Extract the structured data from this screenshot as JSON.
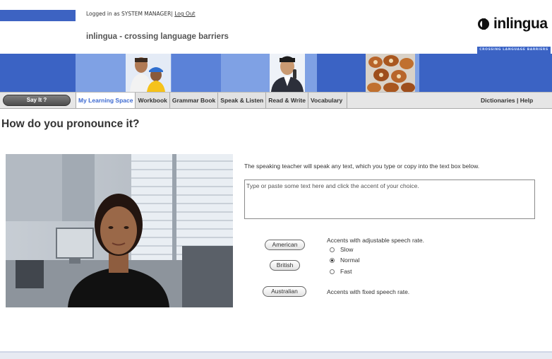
{
  "header": {
    "login_text": "Logged in as SYSTEM MANAGER|",
    "logout_label": "Log Out",
    "tagline": "inlingua - crossing language barriers",
    "logo_text": "inlingua",
    "banner_tagline": "CROSSING LANGUAGE BARRIERS"
  },
  "nav": {
    "say_it_label": "Say It ?",
    "tabs": [
      {
        "label": "My Learning Space",
        "active": true
      },
      {
        "label": "Workbook"
      },
      {
        "label": "Grammar Book"
      },
      {
        "label": "Speak & Listen"
      },
      {
        "label": "Read & Write"
      },
      {
        "label": "Vocabulary"
      }
    ],
    "dictionaries_label": "Dictionaries",
    "separator": " | ",
    "help_label": "Help"
  },
  "main": {
    "title": "How do you pronounce it?",
    "intro": "The speaking teacher will speak any text, which you type or copy into the text box below.",
    "textbox_placeholder": "Type or paste some text here and click the accent of your choice.",
    "accents": {
      "american": "American",
      "british": "British",
      "australian": "Australian"
    },
    "adjustable_note": "Accents with adjustable speech rate.",
    "fixed_note": "Accents with fixed speech rate.",
    "rates": [
      {
        "label": "Slow",
        "checked": false
      },
      {
        "label": "Normal",
        "checked": true
      },
      {
        "label": "Fast",
        "checked": false
      }
    ]
  },
  "colors": {
    "brand_blue": "#3b63c4",
    "banner_light": "#7fa1e4",
    "active_tab_text": "#3d6ad1",
    "nav_bg": "#e6e6e6"
  },
  "icons": {
    "logo_mark": "inlingua-logo-icon"
  }
}
